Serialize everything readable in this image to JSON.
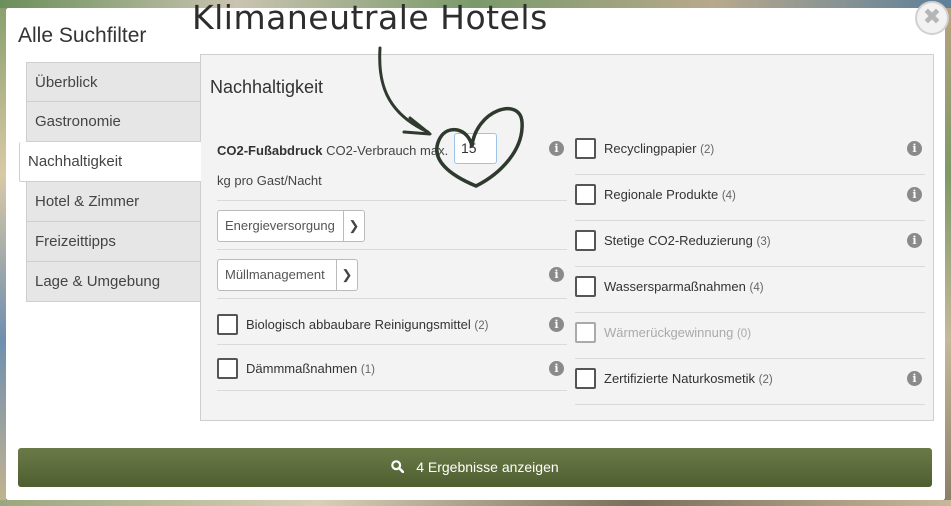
{
  "overlay_title": "Klimaneutrale Hotels",
  "modal": {
    "title": "Alle Suchfilter",
    "close_symbol": "✖"
  },
  "tabs": [
    {
      "label": "Überblick",
      "active": false
    },
    {
      "label": "Gastronomie",
      "active": false
    },
    {
      "label": "Nachhaltigkeit",
      "active": true
    },
    {
      "label": "Hotel & Zimmer",
      "active": false
    },
    {
      "label": "Freizeittipps",
      "active": false
    },
    {
      "label": "Lage & Umgebung",
      "active": false
    }
  ],
  "panel": {
    "title": "Nachhaltigkeit",
    "co2": {
      "label_bold": "CO2-Fußabdruck",
      "label_rest": "CO2-Verbrauch max.",
      "value": "15",
      "unit": "kg pro Gast/Nacht"
    },
    "selects": [
      {
        "value": "Energieversorgung"
      },
      {
        "value": "Müllmanagement"
      }
    ],
    "left_checks": [
      {
        "label": "Biologisch abbaubare Reinigungsmittel",
        "count": "(2)",
        "enabled": true
      },
      {
        "label": "Dämmmaßnahmen",
        "count": "(1)",
        "enabled": true
      }
    ],
    "right_checks": [
      {
        "label": "Recyclingpapier",
        "count": "(2)",
        "enabled": true
      },
      {
        "label": "Regionale Produkte",
        "count": "(4)",
        "enabled": true
      },
      {
        "label": "Stetige CO2-Reduzierung",
        "count": "(3)",
        "enabled": true
      },
      {
        "label": "Wassersparmaßnahmen",
        "count": "(4)",
        "enabled": true
      },
      {
        "label": "Wärmerückgewinnung",
        "count": "(0)",
        "enabled": false
      },
      {
        "label": "Zertifizierte Naturkosmetik",
        "count": "(2)",
        "enabled": true
      }
    ]
  },
  "results_button": {
    "label": "4 Ergebnisse anzeigen"
  },
  "colors": {
    "button": "#5a6a3a",
    "doodle": "#2f3a2e"
  },
  "icons": {
    "info": "info-icon",
    "search": "search-icon",
    "chevron": "chevron-down-icon"
  }
}
